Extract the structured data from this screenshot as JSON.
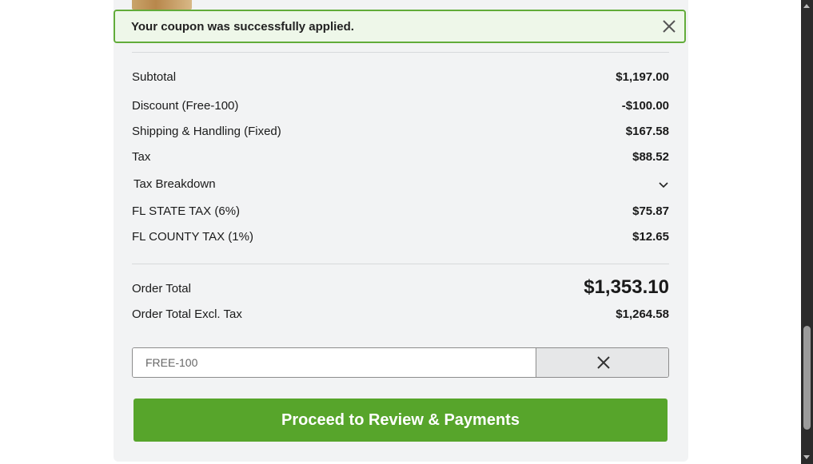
{
  "toast": {
    "message": "Your coupon was successfully applied."
  },
  "summary": {
    "subtotal_label": "Subtotal",
    "subtotal_value": "$1,197.00",
    "discount_label": "Discount (Free-100)",
    "discount_value": "-$100.00",
    "shipping_label": "Shipping & Handling (Fixed)",
    "shipping_value": "$167.58",
    "tax_label": "Tax",
    "tax_value": "$88.52",
    "tax_breakdown_label": "Tax Breakdown",
    "state_tax_label": "FL STATE TAX (6%)",
    "state_tax_value": "$75.87",
    "county_tax_label": "FL COUNTY TAX (1%)",
    "county_tax_value": "$12.65",
    "order_total_label": "Order Total",
    "order_total_value": "$1,353.10",
    "order_total_excl_label": "Order Total Excl. Tax",
    "order_total_excl_value": "$1,264.58"
  },
  "coupon": {
    "value": "FREE-100"
  },
  "actions": {
    "proceed_label": "Proceed to Review & Payments"
  },
  "colors": {
    "accent": "#57a52b",
    "toast_border": "#62ac3a",
    "toast_bg": "#eef7e9",
    "panel_bg": "#f2f3f4"
  }
}
